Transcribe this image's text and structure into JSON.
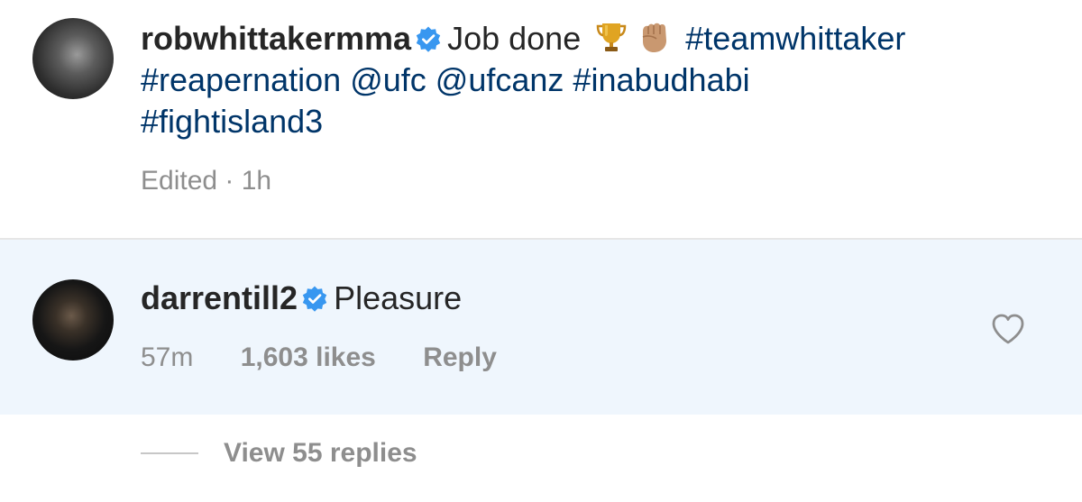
{
  "post": {
    "username": "robwhittakermma",
    "caption_text": "Job done",
    "emojis": [
      "trophy-icon",
      "fist-icon"
    ],
    "hashtag_1": "#teamwhittaker",
    "hashtag_2": "#reapernation",
    "mention_1": "@ufc",
    "mention_2": "@ufcanz",
    "hashtag_3": "#inabudhabi",
    "hashtag_4": "#fightisland3",
    "meta": "Edited · 1h"
  },
  "comment": {
    "username": "darrentill2",
    "text": "Pleasure",
    "time": "57m",
    "likes": "1,603 likes",
    "reply_label": "Reply"
  },
  "replies": {
    "label": "View 55 replies"
  },
  "colors": {
    "link": "#003569",
    "text": "#262626",
    "muted": "#8e8e8e",
    "verified": "#3897f0",
    "comment_bg": "#eff6fd"
  }
}
